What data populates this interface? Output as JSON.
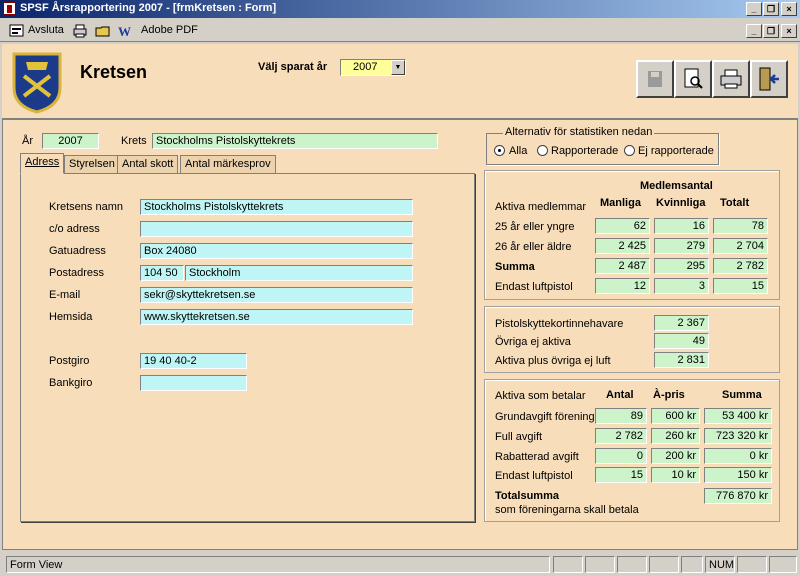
{
  "window": {
    "title": "SPSF Årsrapportering 2007 - [frmKretsen : Form]"
  },
  "menu": {
    "avsluta": "Avsluta",
    "adobe_pdf": "Adobe PDF"
  },
  "header": {
    "title": "Kretsen",
    "year_label": "Välj sparat år",
    "year_value": "2007"
  },
  "top": {
    "ar_label": "År",
    "ar_value": "2007",
    "krets_label": "Krets",
    "krets_value": "Stockholms Pistolskyttekrets"
  },
  "tabs": [
    "Adress",
    "Styrelsen",
    "Antal skott",
    "Antal märkesprov"
  ],
  "address": {
    "kretsens_namn_label": "Kretsens namn",
    "kretsens_namn": "Stockholms Pistolskyttekrets",
    "co_label": "c/o adress",
    "co": "",
    "gatuadress_label": "Gatuadress",
    "gatuadress": "Box 24080",
    "postadress_label": "Postadress",
    "postnr": "104 50",
    "ort": "Stockholm",
    "email_label": "E-mail",
    "email": "sekr@skyttekretsen.se",
    "hemsida_label": "Hemsida",
    "hemsida": "www.skyttekretsen.se",
    "postgiro_label": "Postgiro",
    "postgiro": "19 40 40-2",
    "bankgiro_label": "Bankgiro",
    "bankgiro": ""
  },
  "filter": {
    "title": "Alternativ för statistiken nedan",
    "options": [
      "Alla",
      "Rapporterade",
      "Ej rapporterade"
    ],
    "selected": "Alla"
  },
  "members": {
    "group_title": "Medlemsantal",
    "section": "Aktiva medlemmar",
    "cols": [
      "Manliga",
      "Kvinnliga",
      "Totalt"
    ],
    "rows": [
      {
        "label": "25 år eller yngre",
        "values": [
          "62",
          "16",
          "78"
        ]
      },
      {
        "label": "26 år eller äldre",
        "values": [
          "2 425",
          "279",
          "2 704"
        ]
      },
      {
        "label": "Summa",
        "values": [
          "2 487",
          "295",
          "2 782"
        ]
      },
      {
        "label": "Endast luftpistol",
        "values": [
          "12",
          "3",
          "15"
        ]
      }
    ]
  },
  "others": {
    "rows": [
      {
        "label": "Pistolskyttekortinnehavare",
        "value": "2 367"
      },
      {
        "label": "Övriga ej aktiva",
        "value": "49"
      },
      {
        "label": "Aktiva plus övriga ej luft",
        "value": "2 831"
      }
    ]
  },
  "fees": {
    "section": "Aktiva som betalar",
    "cols": [
      "Antal",
      "À-pris",
      "Summa"
    ],
    "rows": [
      {
        "label": "Grundavgift förening",
        "values": [
          "89",
          "600 kr",
          "53 400 kr"
        ]
      },
      {
        "label": "Full avgift",
        "values": [
          "2 782",
          "260 kr",
          "723 320 kr"
        ]
      },
      {
        "label": "Rabatterad avgift",
        "values": [
          "0",
          "200 kr",
          "0 kr"
        ]
      },
      {
        "label": "Endast luftpistol",
        "values": [
          "15",
          "10 kr",
          "150 kr"
        ]
      }
    ],
    "total_label": "Totalsumma",
    "total_sub": "som föreningarna skall betala",
    "total_value": "776 870 kr"
  },
  "status": {
    "mode": "Form View",
    "num": "NUM"
  },
  "colors": {
    "form_bg": "#f7ddb9",
    "field_cyan": "#bff5f5",
    "field_green": "#ccf3c9",
    "title_blue": "#0a246a"
  }
}
